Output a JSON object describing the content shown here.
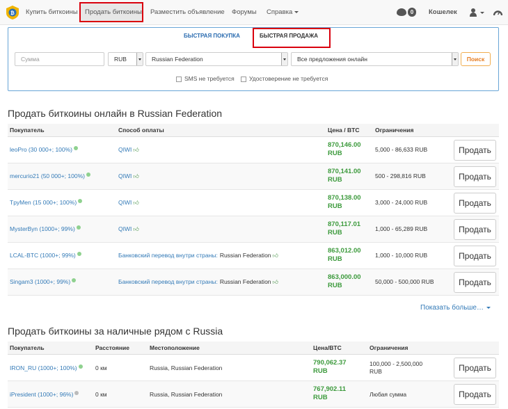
{
  "navbar": {
    "items": [
      {
        "label": "Купить биткоины"
      },
      {
        "label": "Продать биткоины"
      },
      {
        "label": "Разместить объявление"
      },
      {
        "label": "Форумы"
      },
      {
        "label": "Справка"
      }
    ],
    "messages_count": "0",
    "wallet_label": "Кошелек",
    "icons": [
      "logo-icon",
      "chat-icon",
      "user-icon",
      "dashboard-icon"
    ]
  },
  "quick": {
    "tab_buy": "БЫСТРАЯ ПОКУПКА",
    "tab_sell": "БЫСТРАЯ ПРОДАЖА",
    "amount_placeholder": "Сумма",
    "currency": "RUB",
    "country": "Russian Federation",
    "offers": "Все предложения онлайн",
    "search_label": "Поиск",
    "sms_label": "SMS не требуется",
    "id_label": "Удостоверение не требуется"
  },
  "online": {
    "title": "Продать биткоины онлайн в Russian Federation",
    "headers": {
      "buyer": "Покупатель",
      "payment": "Способ оплаты",
      "price": "Цена / BTC",
      "limits": "Ограничения"
    },
    "rows": [
      {
        "buyer": "leoPro (30 000+; 100%)",
        "payment": "QIWI",
        "payment_country": "",
        "price": "870,146.00",
        "currency": "RUB",
        "limits": "5,000 - 86,633 RUB",
        "action": "Продать"
      },
      {
        "buyer": "mercurio21 (50 000+; 100%)",
        "payment": "QIWI",
        "payment_country": "",
        "price": "870,141.00",
        "currency": "RUB",
        "limits": "500 - 298,816 RUB",
        "action": "Продать"
      },
      {
        "buyer": "TpyMen (15 000+; 100%)",
        "payment": "QIWI",
        "payment_country": "",
        "price": "870,138.00",
        "currency": "RUB",
        "limits": "3,000 - 24,000 RUB",
        "action": "Продать"
      },
      {
        "buyer": "MysterByn (1000+; 99%)",
        "payment": "QIWI",
        "payment_country": "",
        "price": "870,117.01",
        "currency": "RUB",
        "limits": "1,000 - 65,289 RUB",
        "action": "Продать"
      },
      {
        "buyer": "LCAL-BTC (1000+; 99%)",
        "payment": "Банковский перевод внутри страны:",
        "payment_country": "Russian Federation",
        "price": "863,012.00",
        "currency": "RUB",
        "limits": "1,000 - 10,000 RUB",
        "action": "Продать"
      },
      {
        "buyer": "Singam3 (1000+; 99%)",
        "payment": "Банковский перевод внутри страны:",
        "payment_country": "Russian Federation",
        "price": "863,000.00",
        "currency": "RUB",
        "limits": "50,000 - 500,000 RUB",
        "action": "Продать"
      }
    ],
    "show_more": "Показать больше…"
  },
  "cash": {
    "title": "Продать биткоины за наличные рядом с Russia",
    "headers": {
      "buyer": "Покупатель",
      "distance": "Расстояние",
      "location": "Местоположение",
      "price": "Цена/BTC",
      "limits": "Ограничения"
    },
    "rows": [
      {
        "buyer": "IRON_RU (1000+; 100%)",
        "distance": "0 км",
        "location": "Russia, Russian Federation",
        "price": "790,062.37",
        "currency": "RUB",
        "limits_line1": "100,000 - 2,500,000",
        "limits_line2": "RUB",
        "action": "Продать",
        "online_status": "online"
      },
      {
        "buyer": "iPresident (1000+; 96%)",
        "distance": "0 км",
        "location": "Russia, Russian Federation",
        "price": "767,902.11",
        "currency": "RUB",
        "limits_line1": "Любая сумма",
        "limits_line2": "",
        "action": "Продать",
        "online_status": "away"
      }
    ]
  },
  "colors": {
    "online_dot": "#8fd18f",
    "away_dot": "#bbbbbb",
    "highlight": "#d9000d",
    "link": "#337ab7",
    "price": "#3c9a3c"
  }
}
